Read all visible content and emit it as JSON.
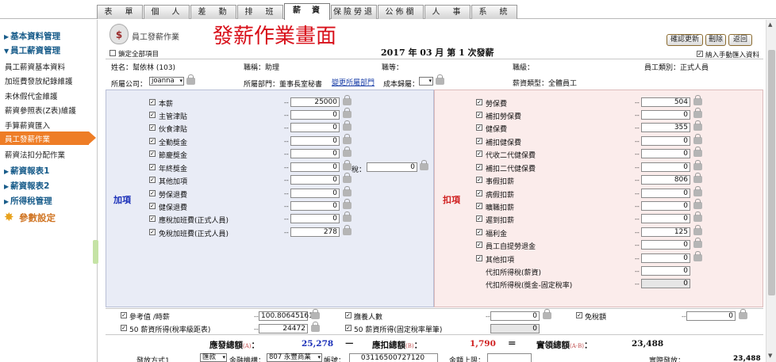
{
  "nav": {
    "tabs": [
      "表　單",
      "個　人",
      "差　勤",
      "排　班",
      "薪　資",
      "保險勞退",
      "公佈欄",
      "人　事",
      "系　統"
    ]
  },
  "sidebar": {
    "basic": "基本資料管理",
    "emp": "員工薪資管理",
    "items": [
      "員工薪資基本資料",
      "加班費發放紀錄維護",
      "未休假代金維護",
      "薪資參照表(Z表)維護",
      "手算薪資匯入"
    ],
    "active": "員工發薪作業",
    "after": "薪資法扣分配作業",
    "r1": "薪資報表1",
    "r2": "薪資報表2",
    "tax": "所得稅管理",
    "param": "參數設定"
  },
  "header": {
    "module": "員工發薪作業",
    "title": "發薪作業畫面",
    "lockall": "鎖定全部項目",
    "period": "2017 年 03 月  第 1 次發薪",
    "btn_confirm": "確認更新",
    "btn_delete": "刪除",
    "btn_back": "返回",
    "manual": "納入手動匯入資料"
  },
  "info": {
    "name": "姓名：幫依林 (103)",
    "title": "職稱：助理",
    "level": "職等：",
    "grade": "職級：",
    "type": "員工類別：正式人員",
    "company_lbl": "所屬公司：",
    "company": "joanna",
    "dept": "所屬部門：董事長室秘書",
    "dept_link": "變更所屬部門",
    "cost_lbl": "成本歸屬：",
    "salary_type": "薪資類型：全體員工"
  },
  "add": {
    "label": "加項",
    "items": [
      {
        "label": "本薪",
        "value": "25000"
      },
      {
        "label": "主管津貼",
        "value": "0"
      },
      {
        "label": "伙食津貼",
        "value": "0"
      },
      {
        "label": "全勤獎金",
        "value": "0"
      },
      {
        "label": "節慶獎金",
        "value": "0"
      },
      {
        "label": "年終獎金",
        "value": "0"
      },
      {
        "label": "其他加項",
        "value": "0"
      },
      {
        "label": "勞保退費",
        "value": "0"
      },
      {
        "label": "健保退費",
        "value": "0"
      },
      {
        "label": "應稅加班費(正式人員)",
        "value": "0"
      },
      {
        "label": "免稅加班費(正式人員)",
        "value": "278"
      }
    ],
    "tax_lbl": "稅：",
    "tax_value": "0"
  },
  "ded": {
    "label": "扣項",
    "items": [
      {
        "label": "勞保費",
        "value": "504"
      },
      {
        "label": "補扣勞保費",
        "value": "0"
      },
      {
        "label": "健保費",
        "value": "355"
      },
      {
        "label": "補扣健保費",
        "value": "0"
      },
      {
        "label": "代收二代健保費",
        "value": "0"
      },
      {
        "label": "補扣二代健保費",
        "value": "0"
      },
      {
        "label": "事假扣薪",
        "value": "806"
      },
      {
        "label": "病假扣薪",
        "value": "0"
      },
      {
        "label": "曠職扣薪",
        "value": "0"
      },
      {
        "label": "遲到扣薪",
        "value": "0"
      },
      {
        "label": "福利金",
        "value": "125"
      },
      {
        "label": "員工自提勞退金",
        "value": "0"
      },
      {
        "label": "其他扣項",
        "value": "0"
      }
    ],
    "tax1_lbl": "代扣所得稅(薪資)",
    "tax1": "0",
    "tax2_lbl": "代扣所得稅(獎金-固定稅率)",
    "tax2": "0"
  },
  "ref": {
    "r1_lbl": "參考值 /時薪",
    "r1": "100.806451612",
    "r2_lbl": "50 薪資所得(稅率級距表)",
    "r2": "24472",
    "dep_lbl": "撫養人數",
    "dep": "0",
    "fix_lbl": "50 薪資所得(固定稅率單筆)",
    "fix": "0",
    "exempt_lbl": "免稅額",
    "exempt": "0"
  },
  "totals": {
    "gross_lbl": "應發總額",
    "gross_sub": "(A)",
    "gross": "25,278",
    "minus": "—",
    "ded_lbl": "應扣總額",
    "ded_sub": "(B)",
    "ded": "1,790",
    "eq": "＝",
    "net_lbl": "實領總額",
    "net_sub": "(A-B)",
    "net": "23,488"
  },
  "pay": {
    "method_lbl": "發放方式1",
    "method": "匯款",
    "bank_lbl": "金融機構：",
    "bank": "807 永豐商業",
    "acct_lbl": "帳號：",
    "acct": "03116500727120",
    "limit_lbl": "金額上限：",
    "actual_lbl": "實際發放：",
    "actual": "23,488"
  },
  "colors": {
    "active": "#ee7d26",
    "title": "#d8101a",
    "add_bg": "#e9ecf6",
    "ded_bg": "#fbeceb"
  }
}
